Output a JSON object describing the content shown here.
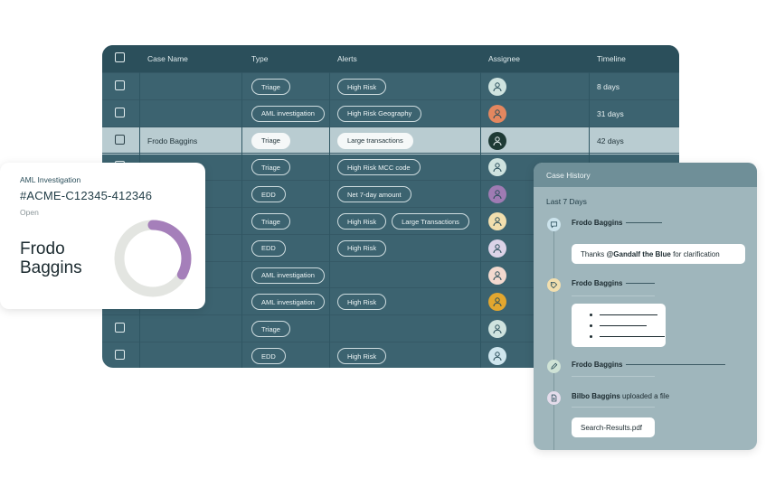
{
  "table": {
    "headers": {
      "case_name": "Case Name",
      "type": "Type",
      "alerts": "Alerts",
      "assignee": "Assignee",
      "timeline": "Timeline"
    },
    "rows": [
      {
        "case_name": "",
        "type": "Triage",
        "alerts": [
          "High Risk"
        ],
        "avatar_color": "#cfe3df",
        "timeline": "8 days",
        "selected": false
      },
      {
        "case_name": "",
        "type": "AML investigation",
        "alerts": [
          "High Risk Geography"
        ],
        "avatar_color": "#e4875f",
        "timeline": "31 days",
        "selected": false
      },
      {
        "case_name": "Frodo Baggins",
        "type": "Triage",
        "alerts": [
          "Large transactions"
        ],
        "avatar_color": "#1e3a35",
        "timeline": "42 days",
        "selected": true
      },
      {
        "case_name": "",
        "type": "Triage",
        "alerts": [
          "High Risk MCC code"
        ],
        "avatar_color": "#cfe3df",
        "timeline": "",
        "selected": false
      },
      {
        "case_name": "",
        "type": "EDD",
        "alerts": [
          "Net 7-day amount"
        ],
        "avatar_color": "#9f7bb3",
        "timeline": "",
        "selected": false
      },
      {
        "case_name": "",
        "type": "Triage",
        "alerts": [
          "High Risk",
          "Large Transactions"
        ],
        "avatar_color": "#f2dfae",
        "timeline": "",
        "selected": false
      },
      {
        "case_name": "",
        "type": "EDD",
        "alerts": [
          "High Risk"
        ],
        "avatar_color": "#dcd3e8",
        "timeline": "",
        "selected": false
      },
      {
        "case_name": "",
        "type": "AML investigation",
        "alerts": [],
        "avatar_color": "#f3d9cf",
        "timeline": "",
        "selected": false
      },
      {
        "case_name": "",
        "type": "AML investigation",
        "alerts": [
          "High Risk"
        ],
        "avatar_color": "#e3a72f",
        "timeline": "",
        "selected": false
      },
      {
        "case_name": "",
        "type": "Triage",
        "alerts": [],
        "avatar_color": "#cfe3df",
        "timeline": "",
        "selected": false
      },
      {
        "case_name": "",
        "type": "EDD",
        "alerts": [
          "High Risk"
        ],
        "avatar_color": "#cfe6ee",
        "timeline": "",
        "selected": false
      }
    ]
  },
  "investigation": {
    "type": "AML Investigation",
    "case_id": "#ACME-C12345-412346",
    "status": "Open",
    "name": "Frodo Baggins",
    "progress_fraction": 0.33,
    "progress_color": "#a57fba",
    "track_color": "#e3e5e1"
  },
  "history": {
    "title": "Case History",
    "period": "Last 7 Days",
    "events": {
      "comment": {
        "author": "Frodo Baggins",
        "pre": "Thanks ",
        "mention": "@Gandalf the Blue",
        "post": " for clarification",
        "icon": "chat-icon",
        "icon_color": "#cbe3ec"
      },
      "tag": {
        "author": "Frodo Baggins",
        "icon": "tag-icon",
        "icon_color": "#f2dfae"
      },
      "edit": {
        "author": "Frodo Baggins",
        "icon": "pencil-icon",
        "icon_color": "#cfe3d6"
      },
      "upload": {
        "author": "Bilbo Baggins",
        "action": "uploaded a file",
        "file": "Search-Results.pdf",
        "icon": "file-icon",
        "icon_color": "#e4dceb"
      }
    }
  }
}
